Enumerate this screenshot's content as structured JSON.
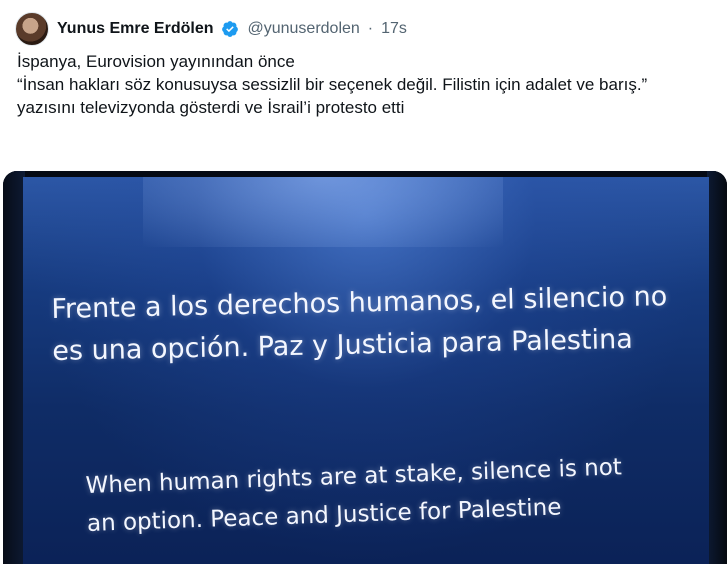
{
  "tweet": {
    "author_name": "Yunus Emre Erdölen",
    "handle": "@yunuserdolen",
    "separator": "·",
    "time": "17s",
    "verified_icon": "verified-badge-icon",
    "avatar_icon": "avatar",
    "lines": [
      "İspanya, Eurovision yayınından önce",
      "“İnsan hakları söz konusuysa sessizlil bir seçenek değil. Filistin için adalet ve barış.”",
      "yazısını televizyonda gösterdi ve İsrail’i protesto etti"
    ]
  },
  "media": {
    "spanish_line1": "Frente a los derechos humanos, el silencio no",
    "spanish_line2": "es una opción. Paz y Justicia para Palestina",
    "english_line1": "When human rights are at stake, silence is not",
    "english_line2": "an option. Peace and Justice for Palestine"
  },
  "colors": {
    "verified_blue": "#1d9bf0",
    "handle_gray": "#536471",
    "screen_blue": "#163a7e"
  }
}
